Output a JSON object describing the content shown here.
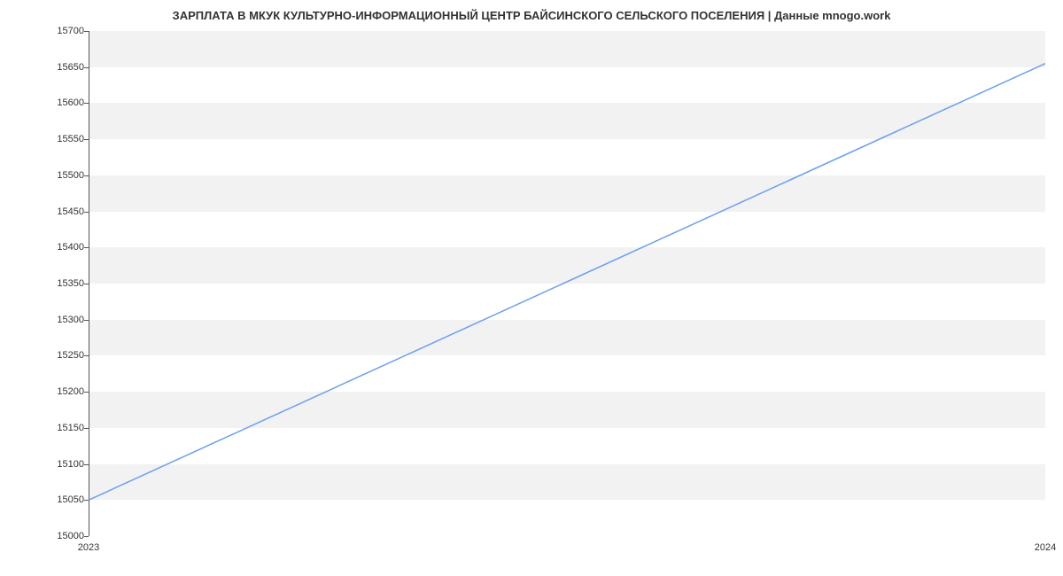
{
  "chart_data": {
    "type": "line",
    "title": "ЗАРПЛАТА В МКУК КУЛЬТУРНО-ИНФОРМАЦИОННЫЙ ЦЕНТР БАЙСИНСКОГО СЕЛЬСКОГО ПОСЕЛЕНИЯ | Данные mnogo.work",
    "xlabel": "",
    "ylabel": "",
    "ylim": [
      15000,
      15700
    ],
    "x_categories": [
      "2023",
      "2024"
    ],
    "y_ticks": [
      15000,
      15050,
      15100,
      15150,
      15200,
      15250,
      15300,
      15350,
      15400,
      15450,
      15500,
      15550,
      15600,
      15650,
      15700
    ],
    "series": [
      {
        "name": "salary",
        "color": "#6a9ff0",
        "x": [
          "2023",
          "2024"
        ],
        "values": [
          15050,
          15655
        ]
      }
    ]
  }
}
